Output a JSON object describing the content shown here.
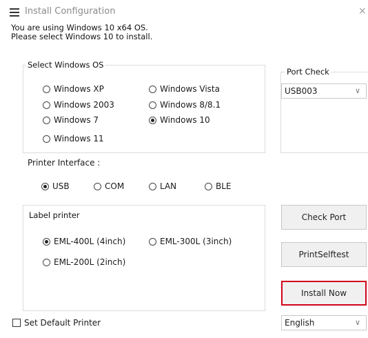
{
  "window": {
    "title": "Install Configuration",
    "close_label": "×"
  },
  "info": {
    "line1": "You are using Windows 10 x64 OS.",
    "line2": "Please select Windows 10 to install."
  },
  "os_group": {
    "legend": "Select Windows OS",
    "options": [
      {
        "label": "Windows XP",
        "selected": false
      },
      {
        "label": "Windows Vista",
        "selected": false
      },
      {
        "label": "Windows 2003",
        "selected": false
      },
      {
        "label": "Windows 8/8.1",
        "selected": false
      },
      {
        "label": "Windows 7",
        "selected": false
      },
      {
        "label": "Windows 10",
        "selected": true
      },
      {
        "label": "Windows 11",
        "selected": false
      }
    ]
  },
  "port_group": {
    "legend": "Port Check",
    "selected_port": "USB003"
  },
  "interface": {
    "label": "Printer Interface :",
    "options": [
      {
        "label": "USB",
        "selected": true
      },
      {
        "label": "COM",
        "selected": false
      },
      {
        "label": "LAN",
        "selected": false
      },
      {
        "label": "BLE",
        "selected": false
      }
    ]
  },
  "label_group": {
    "legend": "Label printer",
    "options": [
      {
        "label": "EML-400L (4inch)",
        "selected": true
      },
      {
        "label": "EML-300L (3inch)",
        "selected": false
      },
      {
        "label": "EML-200L (2inch)",
        "selected": false
      }
    ]
  },
  "buttons": {
    "check_port": "Check Port",
    "print_selftest": "PrintSelftest",
    "install_now": "Install Now"
  },
  "footer": {
    "default_printer_label": "Set Default Printer",
    "default_printer_checked": false,
    "language": "English"
  }
}
